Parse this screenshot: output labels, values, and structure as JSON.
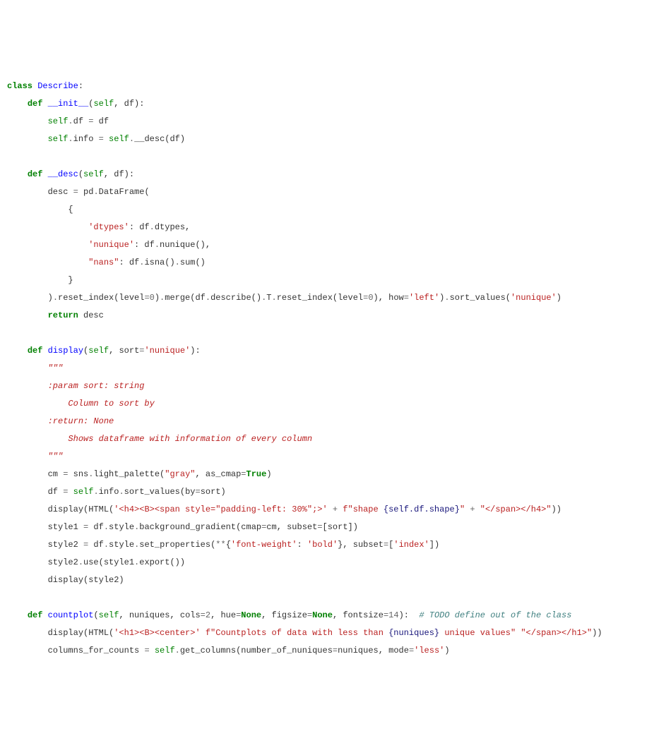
{
  "lines": [
    [
      {
        "t": "class ",
        "c": "kw"
      },
      {
        "t": "Describe",
        "c": "cls"
      },
      {
        "t": ":",
        "c": "nc"
      }
    ],
    [
      {
        "t": "    ",
        "c": "nc"
      },
      {
        "t": "def ",
        "c": "kw"
      },
      {
        "t": "__init__",
        "c": "fn-blue"
      },
      {
        "t": "(",
        "c": "nc"
      },
      {
        "t": "self",
        "c": "self"
      },
      {
        "t": ", df):",
        "c": "nc"
      }
    ],
    [
      {
        "t": "        ",
        "c": "nc"
      },
      {
        "t": "self",
        "c": "self"
      },
      {
        "t": ".",
        "c": "op"
      },
      {
        "t": "df ",
        "c": "nc"
      },
      {
        "t": "=",
        "c": "op"
      },
      {
        "t": " df",
        "c": "nc"
      }
    ],
    [
      {
        "t": "        ",
        "c": "nc"
      },
      {
        "t": "self",
        "c": "self"
      },
      {
        "t": ".",
        "c": "op"
      },
      {
        "t": "info ",
        "c": "nc"
      },
      {
        "t": "=",
        "c": "op"
      },
      {
        "t": " ",
        "c": "nc"
      },
      {
        "t": "self",
        "c": "self"
      },
      {
        "t": ".",
        "c": "op"
      },
      {
        "t": "__desc(df)",
        "c": "nc"
      }
    ],
    [],
    [
      {
        "t": "    ",
        "c": "nc"
      },
      {
        "t": "def ",
        "c": "kw"
      },
      {
        "t": "__desc",
        "c": "fn-blue"
      },
      {
        "t": "(",
        "c": "nc"
      },
      {
        "t": "self",
        "c": "self"
      },
      {
        "t": ", df):",
        "c": "nc"
      }
    ],
    [
      {
        "t": "        desc ",
        "c": "nc"
      },
      {
        "t": "=",
        "c": "op"
      },
      {
        "t": " pd",
        "c": "nc"
      },
      {
        "t": ".",
        "c": "op"
      },
      {
        "t": "DataFrame(",
        "c": "nc"
      }
    ],
    [
      {
        "t": "            {",
        "c": "nc"
      }
    ],
    [
      {
        "t": "                ",
        "c": "nc"
      },
      {
        "t": "'dtypes'",
        "c": "str"
      },
      {
        "t": ": df",
        "c": "nc"
      },
      {
        "t": ".",
        "c": "op"
      },
      {
        "t": "dtypes,",
        "c": "nc"
      }
    ],
    [
      {
        "t": "                ",
        "c": "nc"
      },
      {
        "t": "'nunique'",
        "c": "str"
      },
      {
        "t": ": df",
        "c": "nc"
      },
      {
        "t": ".",
        "c": "op"
      },
      {
        "t": "nunique(),",
        "c": "nc"
      }
    ],
    [
      {
        "t": "                ",
        "c": "nc"
      },
      {
        "t": "\"nans\"",
        "c": "str"
      },
      {
        "t": ": df",
        "c": "nc"
      },
      {
        "t": ".",
        "c": "op"
      },
      {
        "t": "isna()",
        "c": "nc"
      },
      {
        "t": ".",
        "c": "op"
      },
      {
        "t": "sum()",
        "c": "nc"
      }
    ],
    [
      {
        "t": "            }",
        "c": "nc"
      }
    ],
    [
      {
        "t": "        )",
        "c": "nc"
      },
      {
        "t": ".",
        "c": "op"
      },
      {
        "t": "reset_index(level",
        "c": "nc"
      },
      {
        "t": "=",
        "c": "op"
      },
      {
        "t": "0",
        "c": "num"
      },
      {
        "t": ")",
        "c": "nc"
      },
      {
        "t": ".",
        "c": "op"
      },
      {
        "t": "merge(df",
        "c": "nc"
      },
      {
        "t": ".",
        "c": "op"
      },
      {
        "t": "describe()",
        "c": "nc"
      },
      {
        "t": ".",
        "c": "op"
      },
      {
        "t": "T",
        "c": "nc"
      },
      {
        "t": ".",
        "c": "op"
      },
      {
        "t": "reset_index(level",
        "c": "nc"
      },
      {
        "t": "=",
        "c": "op"
      },
      {
        "t": "0",
        "c": "num"
      },
      {
        "t": "), how",
        "c": "nc"
      },
      {
        "t": "=",
        "c": "op"
      },
      {
        "t": "'left'",
        "c": "str"
      },
      {
        "t": ")",
        "c": "nc"
      },
      {
        "t": ".",
        "c": "op"
      },
      {
        "t": "sort_values(",
        "c": "nc"
      },
      {
        "t": "'nunique'",
        "c": "str"
      },
      {
        "t": ")",
        "c": "nc"
      }
    ],
    [
      {
        "t": "        ",
        "c": "nc"
      },
      {
        "t": "return",
        "c": "kw"
      },
      {
        "t": " desc",
        "c": "nc"
      }
    ],
    [],
    [
      {
        "t": "    ",
        "c": "nc"
      },
      {
        "t": "def ",
        "c": "kw"
      },
      {
        "t": "display",
        "c": "fn-blue"
      },
      {
        "t": "(",
        "c": "nc"
      },
      {
        "t": "self",
        "c": "self"
      },
      {
        "t": ", sort",
        "c": "nc"
      },
      {
        "t": "=",
        "c": "op"
      },
      {
        "t": "'nunique'",
        "c": "str"
      },
      {
        "t": "):",
        "c": "nc"
      }
    ],
    [
      {
        "t": "        ",
        "c": "nc"
      },
      {
        "t": "\"\"\"",
        "c": "docstr"
      }
    ],
    [
      {
        "t": "        :param sort: string",
        "c": "docstr"
      }
    ],
    [
      {
        "t": "            Column to sort by",
        "c": "docstr"
      }
    ],
    [
      {
        "t": "        :return: None",
        "c": "docstr"
      }
    ],
    [
      {
        "t": "            Shows dataframe with information of every column",
        "c": "docstr"
      }
    ],
    [
      {
        "t": "        \"\"\"",
        "c": "docstr"
      }
    ],
    [
      {
        "t": "        cm ",
        "c": "nc"
      },
      {
        "t": "=",
        "c": "op"
      },
      {
        "t": " sns",
        "c": "nc"
      },
      {
        "t": ".",
        "c": "op"
      },
      {
        "t": "light_palette(",
        "c": "nc"
      },
      {
        "t": "\"gray\"",
        "c": "str"
      },
      {
        "t": ", as_cmap",
        "c": "nc"
      },
      {
        "t": "=",
        "c": "op"
      },
      {
        "t": "True",
        "c": "kw"
      },
      {
        "t": ")",
        "c": "nc"
      }
    ],
    [
      {
        "t": "        df ",
        "c": "nc"
      },
      {
        "t": "=",
        "c": "op"
      },
      {
        "t": " ",
        "c": "nc"
      },
      {
        "t": "self",
        "c": "self"
      },
      {
        "t": ".",
        "c": "op"
      },
      {
        "t": "info",
        "c": "nc"
      },
      {
        "t": ".",
        "c": "op"
      },
      {
        "t": "sort_values(by",
        "c": "nc"
      },
      {
        "t": "=",
        "c": "op"
      },
      {
        "t": "sort)",
        "c": "nc"
      }
    ],
    [
      {
        "t": "        display(HTML(",
        "c": "nc"
      },
      {
        "t": "'<h4><B><span style=\"padding-left: 30%\";>'",
        "c": "str"
      },
      {
        "t": " ",
        "c": "nc"
      },
      {
        "t": "+",
        "c": "op"
      },
      {
        "t": " ",
        "c": "nc"
      },
      {
        "t": "f\"shape ",
        "c": "str"
      },
      {
        "t": "{self.df.shape}",
        "c": "fn-teal"
      },
      {
        "t": "\"",
        "c": "str"
      },
      {
        "t": " ",
        "c": "nc"
      },
      {
        "t": "+",
        "c": "op"
      },
      {
        "t": " ",
        "c": "nc"
      },
      {
        "t": "\"</span></h4>\"",
        "c": "str"
      },
      {
        "t": "))",
        "c": "nc"
      }
    ],
    [
      {
        "t": "        style1 ",
        "c": "nc"
      },
      {
        "t": "=",
        "c": "op"
      },
      {
        "t": " df",
        "c": "nc"
      },
      {
        "t": ".",
        "c": "op"
      },
      {
        "t": "style",
        "c": "nc"
      },
      {
        "t": ".",
        "c": "op"
      },
      {
        "t": "background_gradient(cmap",
        "c": "nc"
      },
      {
        "t": "=",
        "c": "op"
      },
      {
        "t": "cm, subset",
        "c": "nc"
      },
      {
        "t": "=",
        "c": "op"
      },
      {
        "t": "[sort])",
        "c": "nc"
      }
    ],
    [
      {
        "t": "        style2 ",
        "c": "nc"
      },
      {
        "t": "=",
        "c": "op"
      },
      {
        "t": " df",
        "c": "nc"
      },
      {
        "t": ".",
        "c": "op"
      },
      {
        "t": "style",
        "c": "nc"
      },
      {
        "t": ".",
        "c": "op"
      },
      {
        "t": "set_properties(",
        "c": "nc"
      },
      {
        "t": "**",
        "c": "op"
      },
      {
        "t": "{",
        "c": "nc"
      },
      {
        "t": "'font-weight'",
        "c": "str"
      },
      {
        "t": ": ",
        "c": "nc"
      },
      {
        "t": "'bold'",
        "c": "str"
      },
      {
        "t": "}, subset",
        "c": "nc"
      },
      {
        "t": "=",
        "c": "op"
      },
      {
        "t": "[",
        "c": "nc"
      },
      {
        "t": "'index'",
        "c": "str"
      },
      {
        "t": "])",
        "c": "nc"
      }
    ],
    [
      {
        "t": "        style2",
        "c": "nc"
      },
      {
        "t": ".",
        "c": "op"
      },
      {
        "t": "use(style1",
        "c": "nc"
      },
      {
        "t": ".",
        "c": "op"
      },
      {
        "t": "export())",
        "c": "nc"
      }
    ],
    [
      {
        "t": "        display(style2)",
        "c": "nc"
      }
    ],
    [],
    [
      {
        "t": "    ",
        "c": "nc"
      },
      {
        "t": "def ",
        "c": "kw"
      },
      {
        "t": "countplot",
        "c": "fn-blue"
      },
      {
        "t": "(",
        "c": "nc"
      },
      {
        "t": "self",
        "c": "self"
      },
      {
        "t": ", nuniques, cols",
        "c": "nc"
      },
      {
        "t": "=",
        "c": "op"
      },
      {
        "t": "2",
        "c": "num"
      },
      {
        "t": ", hue",
        "c": "nc"
      },
      {
        "t": "=",
        "c": "op"
      },
      {
        "t": "None",
        "c": "kw"
      },
      {
        "t": ", figsize",
        "c": "nc"
      },
      {
        "t": "=",
        "c": "op"
      },
      {
        "t": "None",
        "c": "kw"
      },
      {
        "t": ", fontsize",
        "c": "nc"
      },
      {
        "t": "=",
        "c": "op"
      },
      {
        "t": "14",
        "c": "num"
      },
      {
        "t": "):  ",
        "c": "nc"
      },
      {
        "t": "# TODO define out of the class",
        "c": "comment"
      }
    ],
    [
      {
        "t": "        display(HTML(",
        "c": "nc"
      },
      {
        "t": "'<h1><B><center>'",
        "c": "str"
      },
      {
        "t": " ",
        "c": "nc"
      },
      {
        "t": "f\"Countplots of data with less than ",
        "c": "str"
      },
      {
        "t": "{nuniques}",
        "c": "fn-teal"
      },
      {
        "t": " unique values\"",
        "c": "str"
      },
      {
        "t": " ",
        "c": "nc"
      },
      {
        "t": "\"</span></h1>\"",
        "c": "str"
      },
      {
        "t": "))",
        "c": "nc"
      }
    ],
    [
      {
        "t": "        columns_for_counts ",
        "c": "nc"
      },
      {
        "t": "=",
        "c": "op"
      },
      {
        "t": " ",
        "c": "nc"
      },
      {
        "t": "self",
        "c": "self"
      },
      {
        "t": ".",
        "c": "op"
      },
      {
        "t": "get_columns(number_of_nuniques",
        "c": "nc"
      },
      {
        "t": "=",
        "c": "op"
      },
      {
        "t": "nuniques, mode",
        "c": "nc"
      },
      {
        "t": "=",
        "c": "op"
      },
      {
        "t": "'less'",
        "c": "str"
      },
      {
        "t": ")",
        "c": "nc"
      }
    ]
  ]
}
